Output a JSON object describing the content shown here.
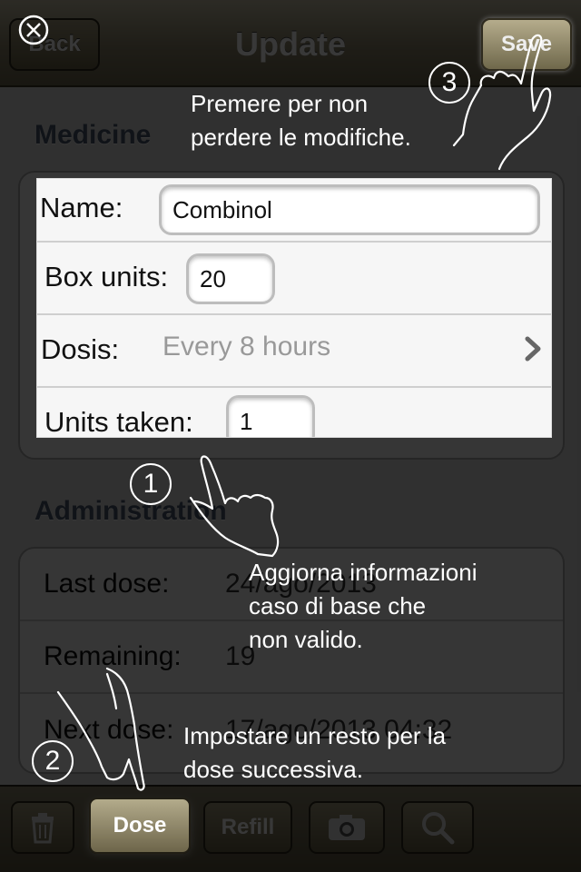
{
  "navbar": {
    "back_label": "Back",
    "title": "Update",
    "save_label": "Save"
  },
  "medicine": {
    "header": "Medicine",
    "name_label": "Name:",
    "name_value": "Combinol",
    "box_units_label": "Box units:",
    "box_units_value": "20",
    "dosis_label": "Dosis:",
    "dosis_value": "Every 8 hours",
    "units_taken_label": "Units taken:",
    "units_taken_value": "1"
  },
  "administration": {
    "header": "Administration",
    "last_dose_label": "Last dose:",
    "last_dose_value": "24/ago/2013",
    "remaining_label": "Remaining:",
    "remaining_value": "19",
    "next_dose_label": "Next dose:",
    "next_dose_value": "17/ago/2013 04:32"
  },
  "toolbar": {
    "dose_label": "Dose",
    "refill_label": "Refill"
  },
  "icons": {
    "trash": "trash-icon",
    "camera": "camera-icon",
    "search": "search-icon",
    "close": "close-icon",
    "chevron": "chevron-right-icon"
  },
  "tutorial": {
    "step1_number": "1",
    "step1_text_line1": "Aggiorna informazioni",
    "step1_text_line2": "caso di base che",
    "step1_text_line3": "non valido.",
    "step2_number": "2",
    "step2_text_line1": "Impostare un resto per la",
    "step2_text_line2": "dose successiva.",
    "step3_number": "3",
    "step3_text_line1": "Premere per non",
    "step3_text_line2": "perdere le modifiche."
  }
}
